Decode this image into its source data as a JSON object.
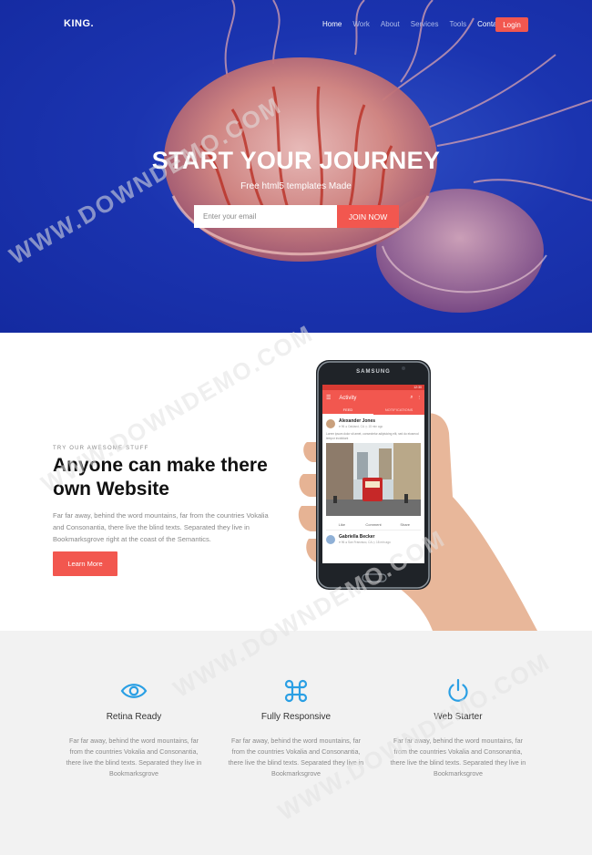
{
  "nav": {
    "logo": "KING.",
    "items": [
      {
        "label": "Home",
        "active": true
      },
      {
        "label": "Work",
        "active": false
      },
      {
        "label": "About",
        "active": false
      },
      {
        "label": "Services",
        "active": false
      },
      {
        "label": "Tools",
        "active": false
      },
      {
        "label": "Contact",
        "active": false
      }
    ],
    "login_label": "Login"
  },
  "hero": {
    "title": "START YOUR JOURNEY",
    "subtitle": "Free html5 templates Made",
    "email_placeholder": "Enter your email",
    "join_label": "JOIN NOW"
  },
  "about": {
    "eyebrow": "TRY OUR AWESOME STUFF",
    "title": "Anyone can make there own Website",
    "text": "Far far away, behind the word mountains, far from the countries Vokalia and Consonantia, there live the blind texts. Separated they live in Bookmarksgrove right at the coast of the Semantics.",
    "button_label": "Learn More"
  },
  "phone": {
    "brand": "SAMSUNG",
    "status_time": "12:30",
    "app_title": "Activity",
    "tabs": [
      "FEED",
      "NOTIFICATIONS"
    ],
    "post1": {
      "name": "Alexander Jones",
      "meta": "♥ 96   ● Oakland, CA   ◷ 15 min ago",
      "text": "Lorem ipsum dolor sit amet, consectetur adipisicing elit, sed do eiusmod tempor incididunt"
    },
    "actions": [
      "Like",
      "Comment",
      "Share"
    ],
    "post2": {
      "name": "Gabriella Becker",
      "meta": "♥ 96   ● San Francisco, CA   ◷ 18 min ago"
    }
  },
  "features": [
    {
      "icon": "eye-icon",
      "title": "Retina Ready",
      "text": "Far far away, behind the word mountains, far from the countries Vokalia and Consonantia, there live the blind texts. Separated they live in Bookmarksgrove"
    },
    {
      "icon": "command-icon",
      "title": "Fully Responsive",
      "text": "Far far away, behind the word mountains, far from the countries Vokalia and Consonantia, there live the blind texts. Separated they live in Bookmarksgrove"
    },
    {
      "icon": "power-icon",
      "title": "Web Starter",
      "text": "Far far away, behind the word mountains, far from the countries Vokalia and Consonantia, there live the blind texts. Separated they live in Bookmarksgrove"
    }
  ],
  "watermark": "WWW.DOWNDEMO.COM",
  "colors": {
    "accent": "#f2574f",
    "icon_blue": "#2a9fe4",
    "hero_blue": "#1b34b0",
    "features_bg": "#f2f2f2"
  }
}
